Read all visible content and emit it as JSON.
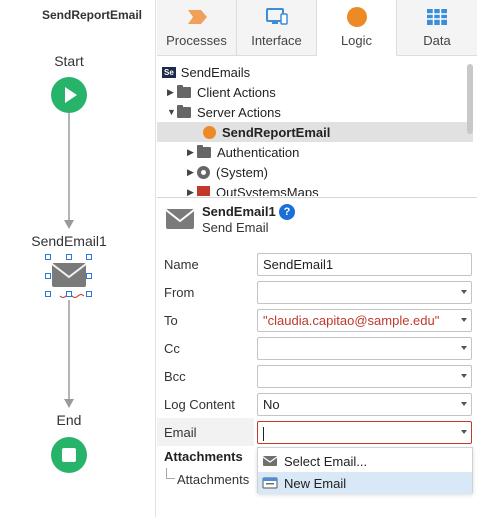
{
  "flow": {
    "title": "SendReportEmail",
    "start_label": "Start",
    "email_label": "SendEmail1",
    "end_label": "End"
  },
  "tabs": [
    {
      "label": "Processes",
      "icon": "processes-chevron-icon",
      "color": "#f0a05a"
    },
    {
      "label": "Interface",
      "icon": "monitor-icon",
      "color": "#3a8fd8"
    },
    {
      "label": "Logic",
      "icon": "logic-circle-icon",
      "color": "#ee8a26"
    },
    {
      "label": "Data",
      "icon": "data-grid-icon",
      "color": "#3a8fd8"
    }
  ],
  "active_tab": "Logic",
  "tree": {
    "root": {
      "badge": "Se",
      "label": "SendEmails"
    },
    "client_actions": "Client Actions",
    "server_actions": "Server Actions",
    "selected_action": "SendReportEmail",
    "authentication": "Authentication",
    "system": "(System)",
    "outsystems_maps": "OutSystemsMaps"
  },
  "properties": {
    "title": "SendEmail1",
    "subtitle": "Send Email",
    "help": "?",
    "rows": {
      "name": {
        "label": "Name",
        "value": "SendEmail1"
      },
      "from": {
        "label": "From",
        "value": ""
      },
      "to": {
        "label": "To",
        "value": "\"claudia.capitao@sample.edu\""
      },
      "cc": {
        "label": "Cc",
        "value": ""
      },
      "bcc": {
        "label": "Bcc",
        "value": ""
      },
      "log_content": {
        "label": "Log Content",
        "value": "No"
      },
      "email": {
        "label": "Email",
        "value": ""
      }
    },
    "attachments_heading": "Attachments",
    "attachments_item": "Attachments"
  },
  "email_menu": {
    "items": [
      {
        "label": "Select Email...",
        "icon": "envelope-icon"
      },
      {
        "label": "New Email",
        "icon": "new-email-icon"
      }
    ]
  },
  "colors": {
    "start_end_green": "#27b36a",
    "logic_orange": "#ee8a26",
    "expression_red": "#c0392b",
    "help_blue": "#1a6fd8",
    "selection_gray": "#e1e1e1",
    "menu_hover": "#d9e8f7"
  }
}
